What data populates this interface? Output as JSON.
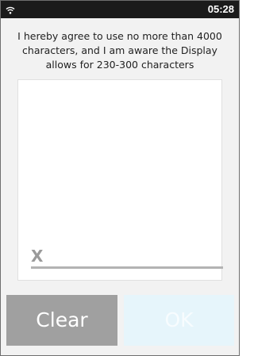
{
  "status_bar": {
    "wifi_icon": "wifi-icon",
    "time": "05:28"
  },
  "prompt": {
    "line1": "I hereby agree to use no more than 4000",
    "line2": "characters, and I am aware the Display",
    "line3": "allows for 230-300 characters"
  },
  "signature": {
    "x_mark": "X"
  },
  "buttons": {
    "clear_label": "Clear",
    "ok_label": "OK",
    "ok_state": "disabled"
  },
  "colors": {
    "status_bar": "#1b1b1b",
    "clear_button": "#a0a0a0",
    "ok_button": "#e6f5fb",
    "signature_line": "#b3b3b3"
  }
}
